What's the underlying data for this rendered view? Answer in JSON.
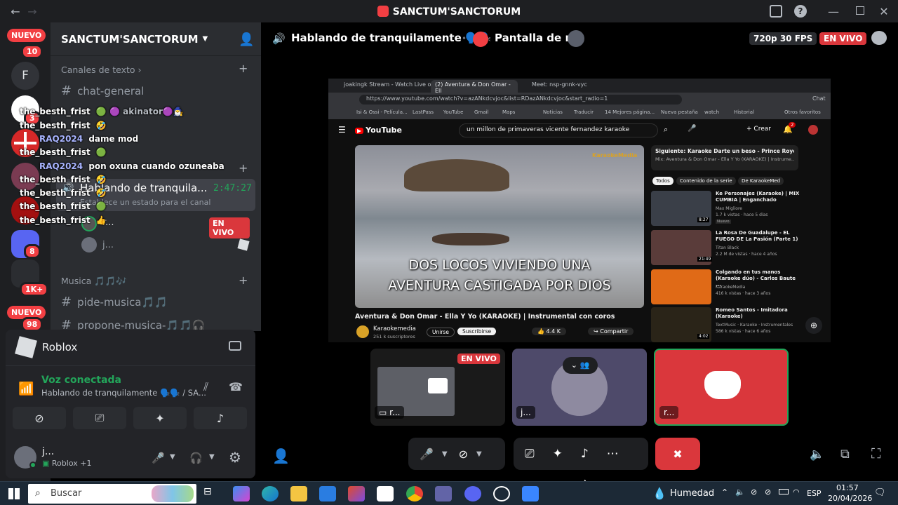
{
  "window": {
    "title": "SANCTUM'SANCTORUM"
  },
  "server": {
    "name": "SANCTUM'SANCTORUM"
  },
  "servers": {
    "new_top": "NUEVO",
    "badge_10": "10",
    "letter": "F",
    "badge_3": "3",
    "badge_8": "8",
    "badge_1k": "1K+",
    "new_bottom": "NUEVO",
    "badge_98": "98"
  },
  "channels": {
    "text_category": "Canales de texto",
    "chat_general": "chat-general",
    "voice_channel": "Hablando de tranquila...",
    "voice_timer": "2:47:27",
    "voice_status": "Establece un estado para el canal",
    "member1": "r...",
    "live_badge": "EN VIVO",
    "member2": "j...",
    "music_category": "Musica 🎵🎵🎶",
    "pide_musica": "pide-musica🎵🎵",
    "propone_musica": "propone-musica-🎵🎵🎧"
  },
  "overlay_chat": [
    {
      "user": "the_besth_frist",
      "msg": "🟢 🟣 akinator🟣🧙‍♂️"
    },
    {
      "user": "the_besth_frist",
      "msg": "🤣"
    },
    {
      "user": "RAQ2024",
      "msg": "dame mod"
    },
    {
      "user": "the_besth_frist",
      "msg": "🟢"
    },
    {
      "user": "RAQ2024",
      "msg": "pon oxuna cuando ozuneaba"
    },
    {
      "user": "the_besth_frist",
      "msg": "🤣"
    },
    {
      "user": "the_besth_frist",
      "msg": "🤣"
    },
    {
      "user": "the_besth_frist",
      "msg": "🟢"
    },
    {
      "user": "the_besth_frist",
      "msg": "👍"
    }
  ],
  "activity": {
    "title": "Roblox"
  },
  "voice": {
    "status": "Voz conectada",
    "channel": "Hablando de tranquilamente 🗣️🗣️ / SA..."
  },
  "user": {
    "name": "j...",
    "activity": "Roblox +1"
  },
  "stage": {
    "channel_title": "Hablando de tranquilamente 🗣️🗣️",
    "share_title": "Pantalla de r...",
    "quality": "720p 30 FPS",
    "live": "EN VIVO"
  },
  "browser": {
    "tabs": [
      "joakingk Stream - Watch Live on K",
      "(2) Aventura & Don Omar - Ell",
      "Meet: nsp-gnnk-vyc"
    ],
    "url": "https://www.youtube.com/watch?v=azANkdcvjoc&list=RDazANkdcvjoc&start_radio=1",
    "bookmarks": [
      "Isi & Ossi - Película...",
      "LastPass",
      "YouTube",
      "Gmail",
      "Maps",
      "Noticias",
      "Traducir",
      "14 Mejores página...",
      "Nueva pestaña",
      "watch",
      "Historial",
      "Otros favoritos"
    ],
    "chat_label": "Chat",
    "search": "un millon de primaveras vicente fernandez karaoke",
    "create": "Crear",
    "notif_count": "2",
    "video_lyric1": "DOS LOCOS VIVIENDO UNA",
    "video_lyric2": "AVENTURA CASTIGADA POR DIOS",
    "watermark": "KaraokeMedia",
    "video_title": "Aventura & Don Omar - Ella Y Yo (KARAOKE) | Instrumental con coros",
    "channel": "Karaokemedia",
    "subs": "251 k suscriptores",
    "join": "Unirse",
    "subscribe": "Suscribirse",
    "likes": "4.4 K",
    "share": "Compartir",
    "next_label": "Siguiente: Karaoke Darte un beso - Prince Royce",
    "mix": "Mix: Aventura & Don Omar - Ella Y Yo (KARAOKE) | Instrume...",
    "chips": [
      "Todos",
      "Contenido de la serie",
      "De KaraokeMed"
    ],
    "related": [
      {
        "title": "Ke Personajes (Karaoke) | MIX CUMBIA | Enganchado",
        "channel": "Max Migliore",
        "meta": "1.7 k vistas · hace 5 días",
        "extra": "Nuevo",
        "dur": "8:27"
      },
      {
        "title": "La Rosa De Guadalupe - EL FUEGO DE La Pasión (Parte 1)",
        "channel": "Titan Black",
        "meta": "2.2 M de vistas · hace 4 años",
        "extra": "",
        "dur": "21:49"
      },
      {
        "title": "Colgando en tus manos (Karaoke dúo) - Carlos Baute ...",
        "channel": "KaraokeMedia",
        "meta": "416 k vistas · hace 3 años",
        "extra": "",
        "dur": ""
      },
      {
        "title": "Romeo Santos - Imitadora (Karaoke)",
        "channel": "TextMusic · Karaoke · Instrumentales",
        "meta": "586 k vistas · hace 6 años",
        "extra": "",
        "dur": "4:02"
      }
    ]
  },
  "tiles": {
    "t1_live": "EN VIVO",
    "t1_name": "r...",
    "t2_name": "j...",
    "t3_name": "r..."
  },
  "taskbar": {
    "search": "Buscar",
    "weather": "Humedad",
    "lang": "ESP",
    "time": "01:57",
    "date": "20/04/2026"
  },
  "colors": {
    "discord_blurple": "#5865f2",
    "live_red": "#da373c",
    "voice_green": "#23a55a",
    "yt_red": "#ff0000"
  }
}
